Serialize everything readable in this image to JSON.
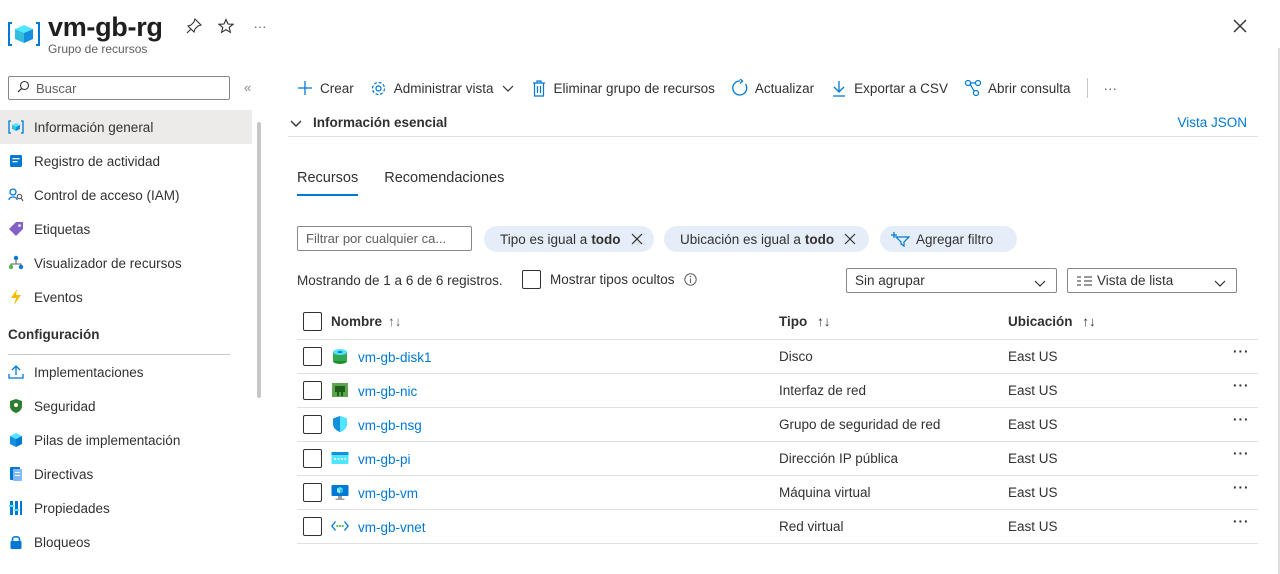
{
  "header": {
    "title": "vm-gb-rg",
    "subtitle": "Grupo de recursos",
    "more": "···"
  },
  "sidebar": {
    "search_placeholder": "Buscar",
    "collapse": "«",
    "items": [
      {
        "label": "Información general",
        "icon": "resource-group-icon",
        "active": true
      },
      {
        "label": "Registro de actividad",
        "icon": "activity-log-icon"
      },
      {
        "label": "Control de acceso (IAM)",
        "icon": "iam-icon"
      },
      {
        "label": "Etiquetas",
        "icon": "tag-icon"
      },
      {
        "label": "Visualizador de recursos",
        "icon": "resource-visualizer-icon"
      },
      {
        "label": "Eventos",
        "icon": "events-icon"
      }
    ],
    "section_title": "Configuración",
    "section_items": [
      {
        "label": "Implementaciones",
        "icon": "deployments-icon"
      },
      {
        "label": "Seguridad",
        "icon": "security-icon"
      },
      {
        "label": "Pilas de implementación",
        "icon": "deployment-stacks-icon"
      },
      {
        "label": "Directivas",
        "icon": "policies-icon"
      },
      {
        "label": "Propiedades",
        "icon": "properties-icon"
      },
      {
        "label": "Bloqueos",
        "icon": "locks-icon"
      }
    ]
  },
  "toolbar": {
    "create": "Crear",
    "manage_view": "Administrar vista",
    "delete_rg": "Eliminar grupo de recursos",
    "refresh": "Actualizar",
    "export_csv": "Exportar a CSV",
    "open_query": "Abrir consulta",
    "more": "···"
  },
  "essentials": {
    "label": "Información esencial",
    "json_view": "Vista JSON"
  },
  "tabs": [
    "Recursos",
    "Recomendaciones"
  ],
  "filters": {
    "input_placeholder": "Filtrar por cualquier ca...",
    "type_filter": {
      "prefix": "Tipo es igual a",
      "value": "todo"
    },
    "location_filter": {
      "prefix": "Ubicación es igual a",
      "value": "todo"
    },
    "add_filter": "Agregar filtro"
  },
  "status": {
    "showing": "Mostrando de 1 a 6 de 6 registros.",
    "show_hidden": "Mostrar tipos ocultos",
    "group_by": "Sin agrupar",
    "view": "Vista de lista"
  },
  "table": {
    "columns": {
      "name": "Nombre",
      "type": "Tipo",
      "location": "Ubicación"
    },
    "rows": [
      {
        "name": "vm-gb-disk1",
        "type": "Disco",
        "location": "East US",
        "icon": "disk-icon"
      },
      {
        "name": "vm-gb-nic",
        "type": "Interfaz de red",
        "location": "East US",
        "icon": "nic-icon"
      },
      {
        "name": "vm-gb-nsg",
        "type": "Grupo de seguridad de red",
        "location": "East US",
        "icon": "nsg-icon"
      },
      {
        "name": "vm-gb-pi",
        "type": "Dirección IP pública",
        "location": "East US",
        "icon": "public-ip-icon"
      },
      {
        "name": "vm-gb-vm",
        "type": "Máquina virtual",
        "location": "East US",
        "icon": "vm-icon"
      },
      {
        "name": "vm-gb-vnet",
        "type": "Red virtual",
        "location": "East US",
        "icon": "vnet-icon"
      }
    ],
    "more": "···"
  },
  "colors": {
    "accent": "#0078d4",
    "pill_bg": "#e5eef8",
    "active_nav": "#edebe9"
  }
}
